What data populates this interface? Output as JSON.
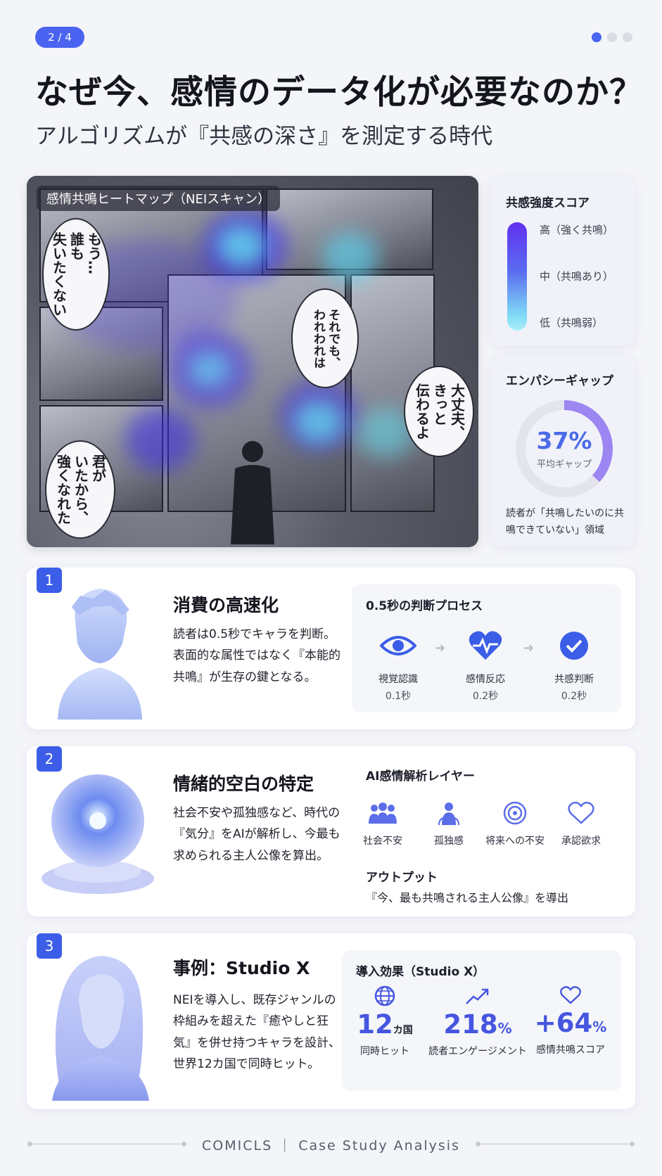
{
  "header": {
    "page_indicator": "2 / 4",
    "title": "なぜ今、感情のデータ化が必要なのか？",
    "subtitle": "アルゴリズムが『共感の深さ』を測定する時代"
  },
  "heatmap": {
    "label": "感情共鳴ヒートマップ（NEIスキャン）",
    "bubbles": [
      "もう…\n誰も\n失いたくない",
      "それでも、\nわれわれは",
      "大丈夫、\nきっと\n伝わるよ",
      "君が\nいたから、\n強くなれた"
    ]
  },
  "score_card": {
    "title": "共感強度スコア",
    "high": "高（強く共鳴）",
    "mid": "中（共鳴あり）",
    "low": "低（共鳴弱）"
  },
  "gap_card": {
    "title": "エンパシーギャップ",
    "value": "37%",
    "value_fraction": 0.37,
    "sub": "平均ギャップ",
    "desc": "読者が「共鳴したいのに共鳴できていない」領域"
  },
  "sections": [
    {
      "number": "1",
      "title": "消費の高速化",
      "body": "読者は0.5秒でキャラを判断。表面的な属性ではなく『本能的共鳴』が生存の鍵となる。",
      "panel_title": "0.5秒の判断プロセス",
      "steps": [
        {
          "label": "視覚認識",
          "time": "0.1秒",
          "icon": "eye-icon"
        },
        {
          "label": "感情反応",
          "time": "0.2秒",
          "icon": "heartbeat-icon"
        },
        {
          "label": "共感判断",
          "time": "0.2秒",
          "icon": "check-circle-icon"
        }
      ]
    },
    {
      "number": "2",
      "title": "情緒的空白の特定",
      "body": "社会不安や孤独感など、時代の『気分』をAIが解析し、今最も求められる主人公像を算出。",
      "panel_title": "AI感情解析レイヤー",
      "layers": [
        {
          "label": "社会不安",
          "icon": "people-icon"
        },
        {
          "label": "孤独感",
          "icon": "person-icon"
        },
        {
          "label": "将来への不安",
          "icon": "network-icon"
        },
        {
          "label": "承認欲求",
          "icon": "heart-icon"
        }
      ],
      "output_title": "アウトプット",
      "output_text": "『今、最も共鳴される主人公像』を導出"
    },
    {
      "number": "3",
      "title": "事例：Studio X",
      "body": "NEIを導入し、既存ジャンルの枠組みを超えた『癒やしと狂気』を併せ持つキャラを設計、世界12カ国で同時ヒット。",
      "panel_title": "導入効果（Studio X）",
      "effects": [
        {
          "value": "12",
          "unit": "カ国",
          "label": "同時ヒット",
          "icon": "globe-icon"
        },
        {
          "value": "218",
          "unit": "%",
          "label": "読者エンゲージメント",
          "icon": "trend-up-icon"
        },
        {
          "value": "+64",
          "unit": "%",
          "label": "感情共鳴スコア",
          "icon": "heart-icon"
        }
      ]
    }
  ],
  "footer": {
    "text": "COMICLS ｜ Case Study Analysis"
  },
  "colors": {
    "accent": "#4a63f0",
    "badge": "#3b5de7",
    "gap_arc": "#9b86f2",
    "effect_number": "#4656e0"
  }
}
